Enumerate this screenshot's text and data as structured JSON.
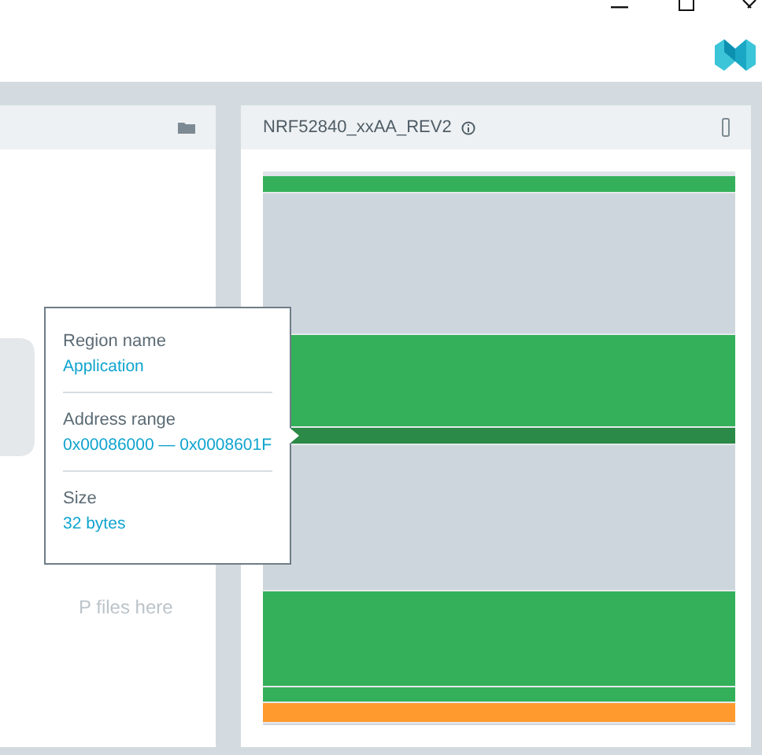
{
  "left_panel": {
    "drop_hint": "P files here"
  },
  "device_panel": {
    "title": "NRF52840_xxAA_REV2"
  },
  "memory_regions": [
    {
      "color": "#34b05a"
    },
    {
      "color": "#ced6dd"
    },
    {
      "color": "#34b05a"
    },
    {
      "color": "#2b8a47"
    },
    {
      "color": "#ced6dd"
    },
    {
      "color": "#34b05a"
    },
    {
      "color": "#34b05a"
    },
    {
      "color": "#ff9a2e"
    }
  ],
  "tooltip": {
    "fields": [
      {
        "label": "Region name",
        "value": "Application"
      },
      {
        "label": "Address range",
        "value": "0x00086000 — 0x0008601F"
      },
      {
        "label": "Size",
        "value": "32 bytes"
      }
    ]
  }
}
